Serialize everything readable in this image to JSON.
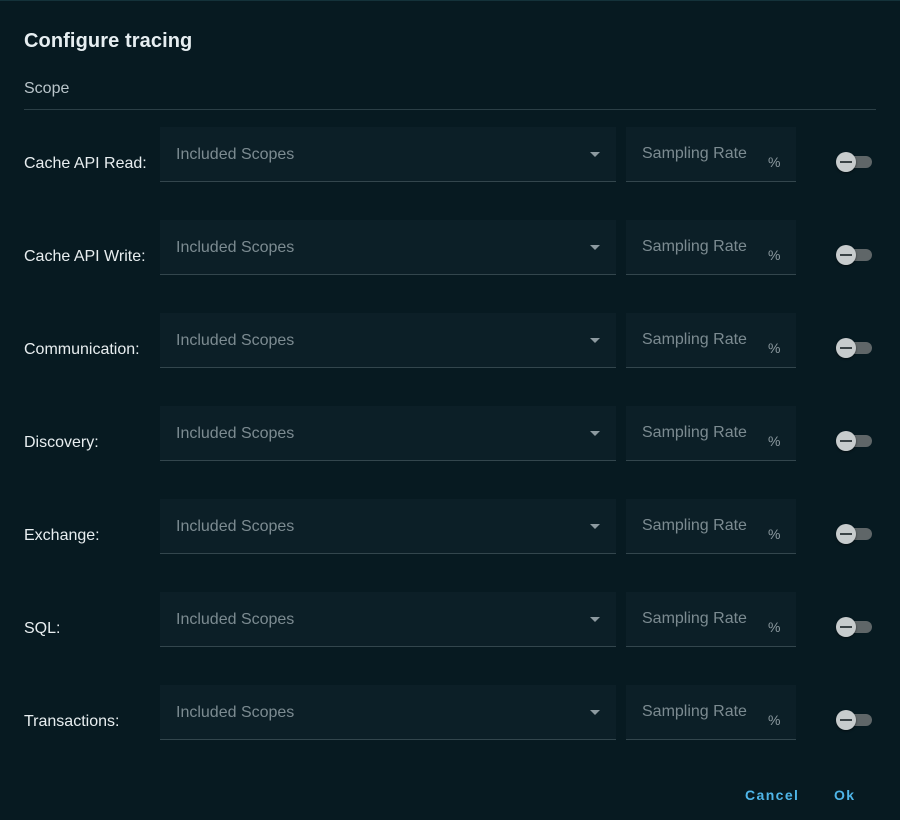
{
  "dialog": {
    "title": "Configure tracing",
    "section_label": "Scope"
  },
  "field_placeholders": {
    "scopes": "Included Scopes",
    "rate": "Sampling Rate",
    "rate_unit": "%"
  },
  "rows": [
    {
      "label": "Cache API Read:",
      "enabled": false
    },
    {
      "label": "Cache API Write:",
      "enabled": false
    },
    {
      "label": "Communication:",
      "enabled": false
    },
    {
      "label": "Discovery:",
      "enabled": false
    },
    {
      "label": "Exchange:",
      "enabled": false
    },
    {
      "label": "SQL:",
      "enabled": false
    },
    {
      "label": "Transactions:",
      "enabled": false
    }
  ],
  "actions": {
    "cancel": "Cancel",
    "ok": "Ok"
  },
  "colors": {
    "background": "#071a21",
    "field": "#0c1f27",
    "accent": "#4fb6e9"
  }
}
